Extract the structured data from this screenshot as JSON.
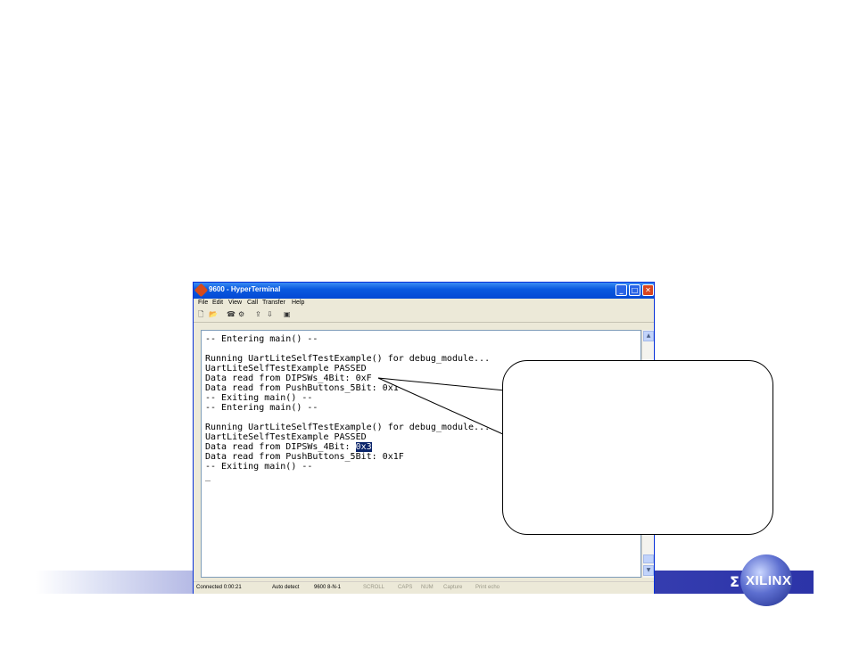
{
  "window": {
    "title": "9600 - HyperTerminal",
    "menu": [
      "File",
      "Edit",
      "View",
      "Call",
      "Transfer",
      "Help"
    ],
    "controls": {
      "minimize": "_",
      "maximize": "□",
      "close": "✕"
    }
  },
  "toolbar": {
    "icons": [
      "new-icon",
      "open-icon",
      "disconnect-icon",
      "properties-icon",
      "send-icon",
      "receive-icon",
      "settings-icon"
    ]
  },
  "terminal": {
    "lines": [
      "-- Entering main() --",
      "",
      "Running UartLiteSelfTestExample() for debug_module...",
      "UartLiteSelfTestExample PASSED",
      "Data read from DIPSWs_4Bit: 0xF",
      "Data read from PushButtons_5Bit: 0x1",
      "-- Exiting main() --",
      "-- Entering main() --",
      "",
      "Running UartLiteSelfTestExample() for debug_module...",
      "UartLiteSelfTestExample PASSED",
      "Data read from DIPSWs_4Bit: ",
      "Data read from PushButtons_5Bit: 0x1F",
      "-- Exiting main() --",
      "_"
    ],
    "highlighted_value": "0x3"
  },
  "statusbar": {
    "connected": "Connected 0:00:21",
    "detect": "Auto detect",
    "settings": "9600 8-N-1",
    "scroll": "SCROLL",
    "caps": "CAPS",
    "num": "NUM",
    "capture": "Capture",
    "print_echo": "Print echo"
  },
  "brand": {
    "logo_text": "XILINX",
    "logo_mark": "Σ",
    "band_color": "#2c34a8"
  }
}
